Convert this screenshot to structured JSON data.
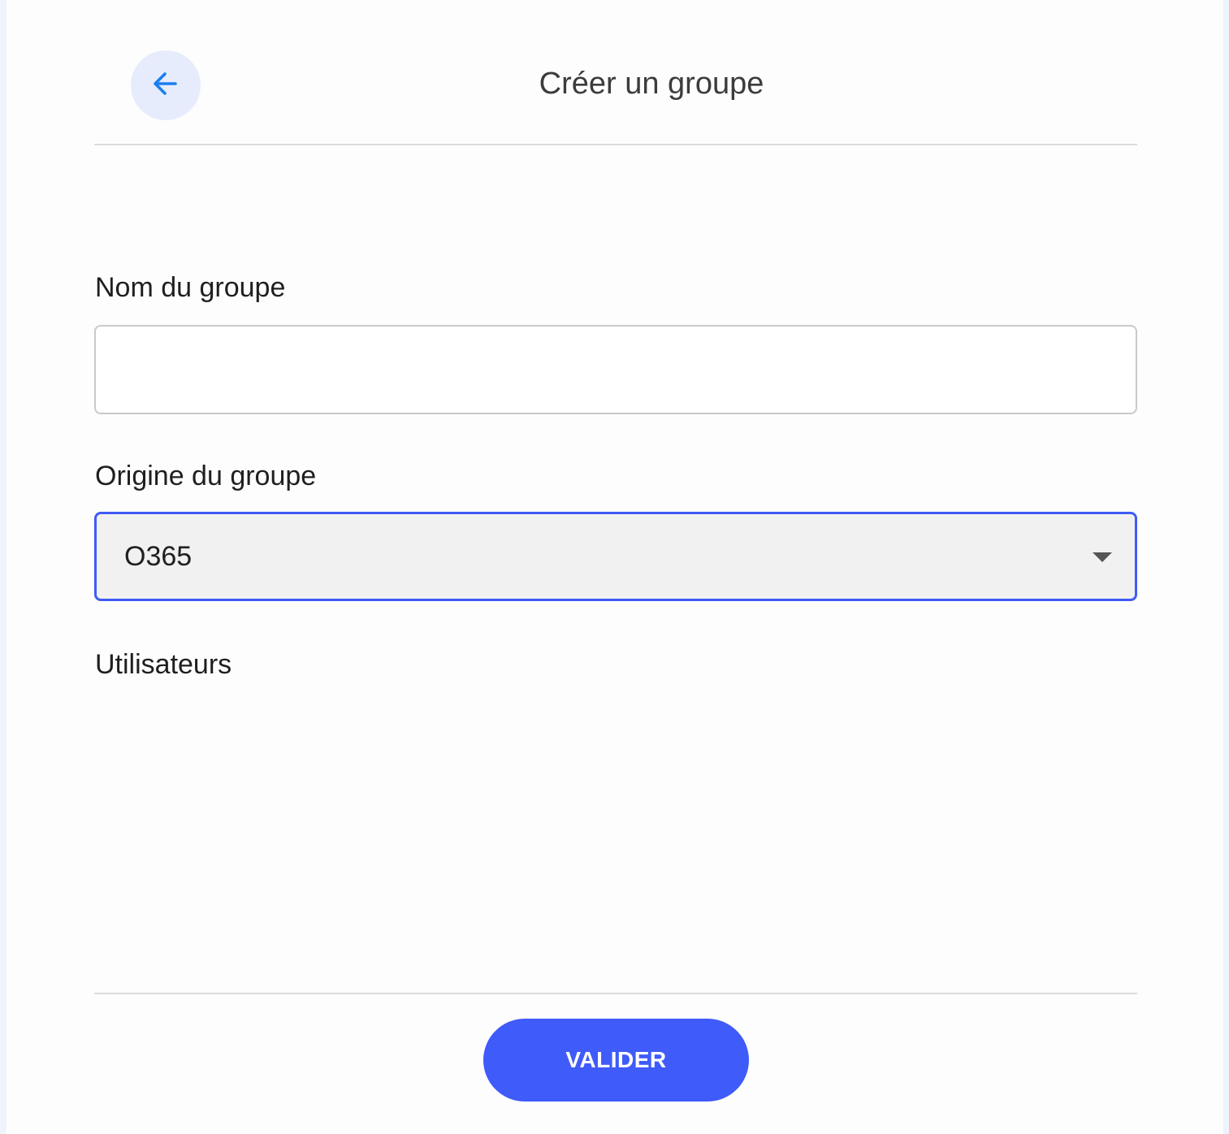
{
  "header": {
    "back_icon": "arrow-left-icon",
    "title": "Créer un groupe"
  },
  "form": {
    "name_label": "Nom du groupe",
    "name_value": "",
    "origin_label": "Origine du groupe",
    "origin_selected": "O365",
    "users_label": "Utilisateurs"
  },
  "footer": {
    "submit_label": "VALIDER"
  },
  "colors": {
    "accent": "#3f5bfa",
    "back_button_bg": "#e6ecfc",
    "back_icon": "#1a7ff0",
    "select_bg": "#f1f1f1",
    "page_bg": "#eef3fc"
  }
}
